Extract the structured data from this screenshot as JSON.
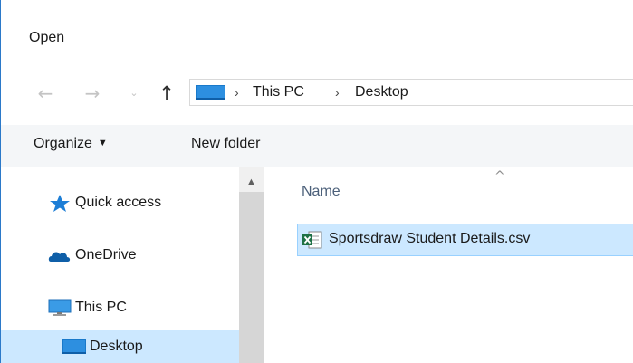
{
  "window": {
    "title": "Open"
  },
  "navigation": {
    "back_icon": "←",
    "forward_icon": "→",
    "recent_icon": "⌄",
    "up_icon": "↑",
    "breadcrumb": [
      "This PC",
      "Desktop"
    ],
    "separator": "›"
  },
  "toolbar": {
    "organize_label": "Organize",
    "organize_caret": "▼",
    "new_folder_label": "New folder"
  },
  "nav_pane": {
    "items": [
      {
        "label": "Quick access",
        "icon": "star-icon"
      },
      {
        "label": "OneDrive",
        "icon": "cloud-icon"
      },
      {
        "label": "This PC",
        "icon": "monitor-icon"
      },
      {
        "label": "Desktop",
        "icon": "desktop-icon",
        "selected": true
      }
    ],
    "scroll_up_icon": "▲"
  },
  "file_list": {
    "column_header": "Name",
    "sort_indicator": "^",
    "files": [
      {
        "name": "Sportsdraw Student Details.csv",
        "icon": "excel-csv-icon",
        "selected": true
      }
    ]
  },
  "colors": {
    "selection": "#cce8ff",
    "selection_border": "#99d1ff",
    "accent": "#0078d7",
    "toolbar_bg": "#f4f6f8"
  }
}
